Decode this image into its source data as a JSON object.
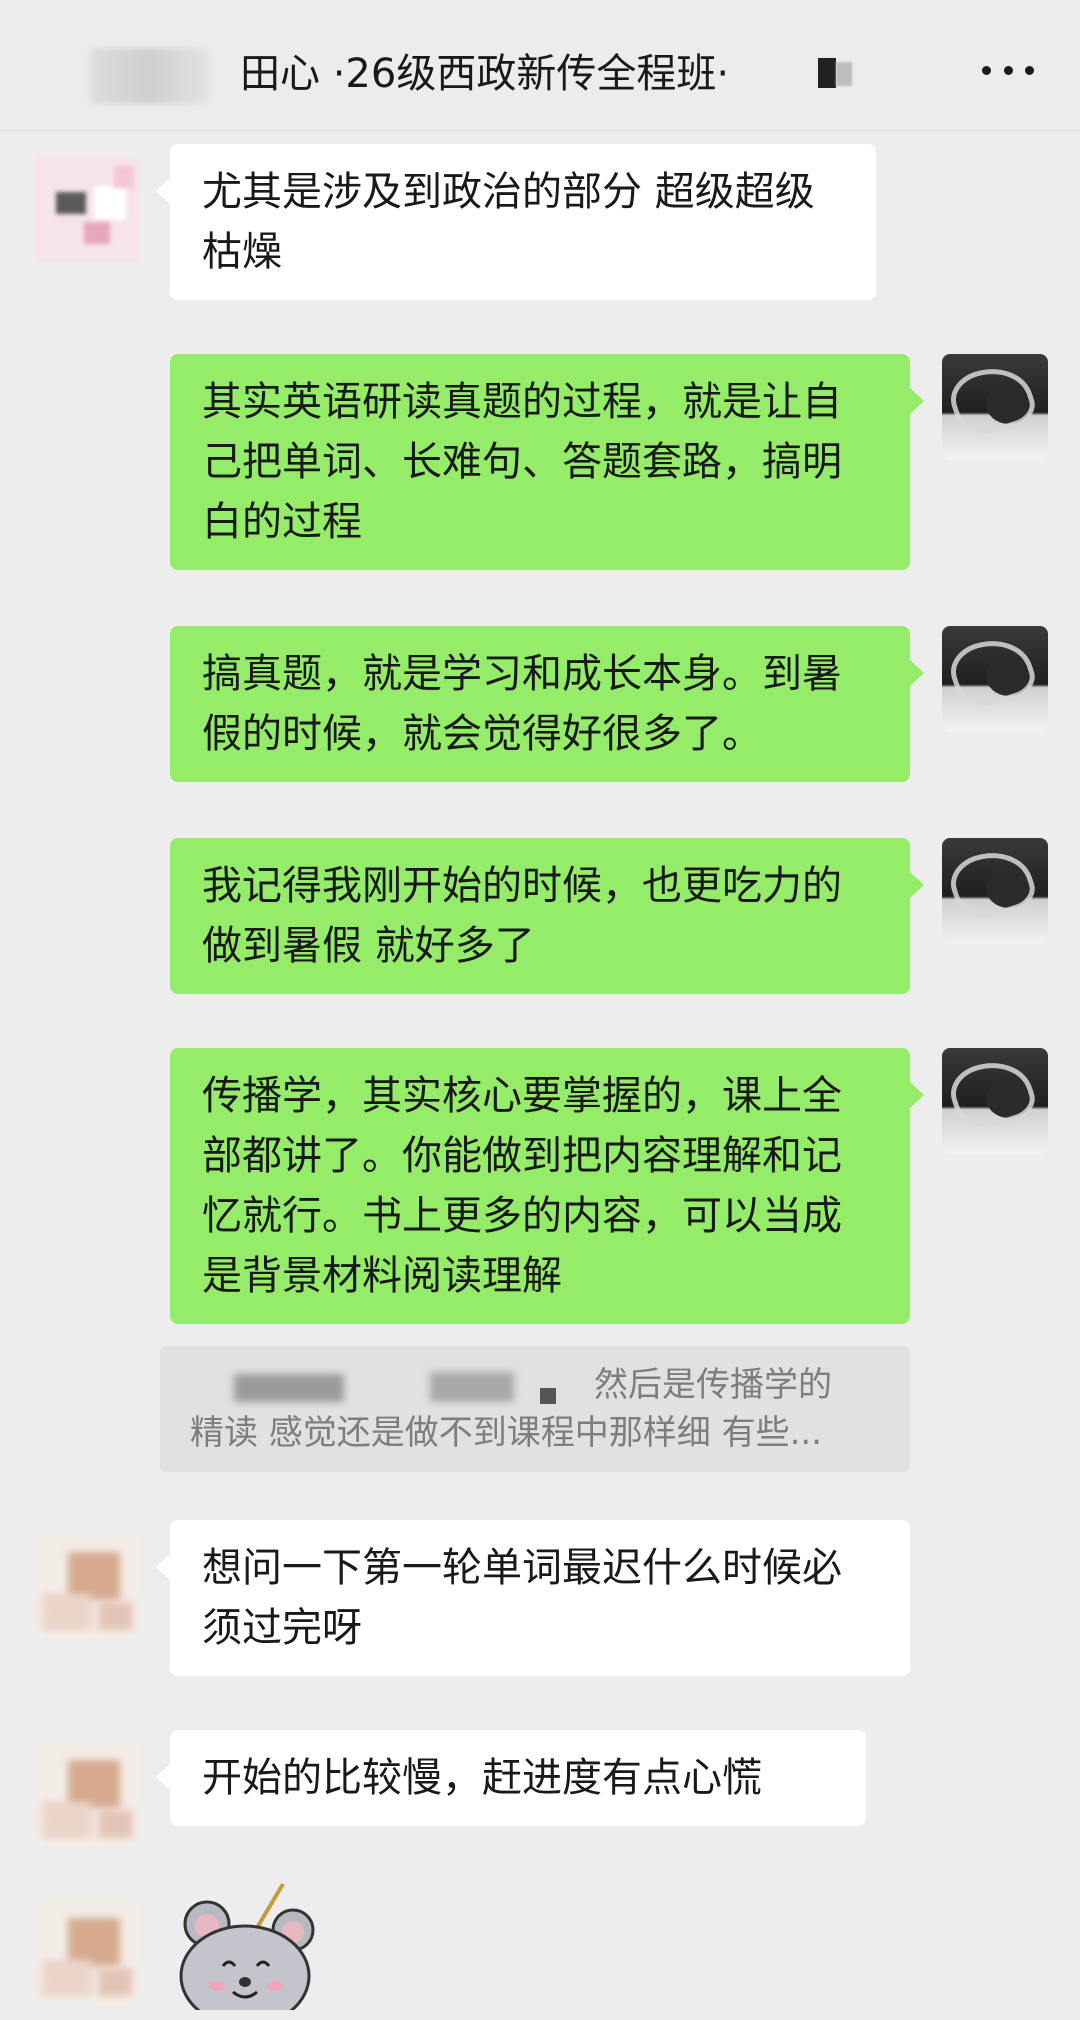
{
  "header": {
    "title": "田心 ·26级西政新传全程班·",
    "more_icon": "more-dots-icon"
  },
  "messages": [
    {
      "side": "left",
      "text": "尤其是涉及到政治的部分 超级超级枯燥"
    },
    {
      "side": "right",
      "text": "其实英语研读真题的过程，就是让自己把单词、长难句、答题套路，搞明白的过程"
    },
    {
      "side": "right",
      "text": "搞真题，就是学习和成长本身。到暑假的时候，就会觉得好很多了。"
    },
    {
      "side": "right",
      "text": "我记得我刚开始的时候，也更吃力的  做到暑假 就好多了"
    },
    {
      "side": "right",
      "text": "传播学，其实核心要掌握的，课上全部都讲了。你能做到把内容理解和记忆就行。书上更多的内容，可以当成是背景材料阅读理解"
    },
    {
      "side": "left",
      "text": "想问一下第一轮单词最迟什么时候必须过完呀"
    },
    {
      "side": "left",
      "text": "开始的比较慢，赶进度有点心慌"
    }
  ],
  "quote": {
    "line1": "然后是传播学的",
    "line2": "精读 感觉还是做不到课程中那样细 有些..."
  },
  "sticker": {
    "name": "mouse-sticker"
  },
  "colors": {
    "background": "#ededed",
    "bubble_self": "#95ec69",
    "bubble_other": "#ffffff"
  }
}
